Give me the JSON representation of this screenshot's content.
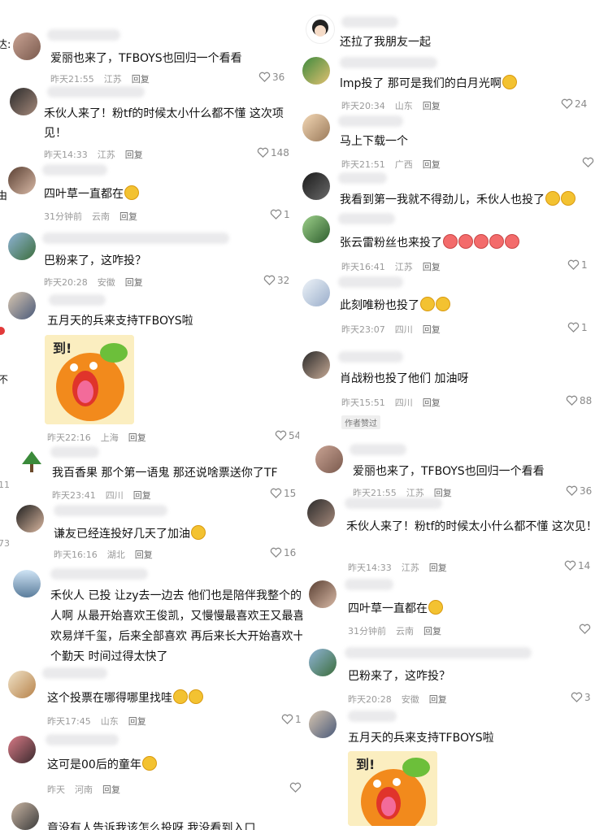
{
  "collage": {
    "left_top": [
      {
        "text": "爱丽也来了，TFBOYS也回归一个看看",
        "time": "昨天21:55",
        "region": "江苏",
        "reply": "回复",
        "likes": "36",
        "emoji": 0
      },
      {
        "text": "禾伙人来了！粉tf的时候太小什么都不懂 这次项见！",
        "time": "昨天14:33",
        "region": "江苏",
        "reply": "回复",
        "likes": "148",
        "emoji": 0
      },
      {
        "text": "四叶草一直都在",
        "time": "31分钟前",
        "region": "云南",
        "reply": "回复",
        "likes": "1",
        "emoji": 1
      },
      {
        "text": "巴粉来了，这咋投？",
        "time": "昨天20:28",
        "region": "安徽",
        "reply": "回复",
        "likes": "32",
        "emoji": 0
      },
      {
        "text": "五月天的兵来支持TFBOYS啦",
        "time": "昨天22:16",
        "region": "上海",
        "reply": "回复",
        "likes": "54",
        "emoji": 0
      }
    ],
    "left_bottom": [
      {
        "text": "我百香果 那个第一语鬼  那还说啥票送你了TF",
        "time": "昨天23:41",
        "region": "四川",
        "reply": "回复",
        "likes": "15"
      },
      {
        "text": "谦友已经连投好几天了加油",
        "time": "昨天16:16",
        "region": "湖北",
        "reply": "回复",
        "likes": "16"
      },
      {
        "text": "禾伙人 已投  让zy去一边去 他们也是陪伴我整个的人啊  从最开始喜欢王俊凯，又慢慢最喜欢王又最喜欢易烊千玺，后来全部喜欢 再后来长大开始喜欢十个勤天  时间过得太快了",
        "time": "",
        "region": "",
        "reply": "",
        "likes": ""
      },
      {
        "text": "这个投票在哪得哪里找哇",
        "time": "昨天17:45",
        "region": "山东",
        "reply": "回复",
        "likes": "1"
      },
      {
        "text": "这可是00后的童年",
        "time": "昨天",
        "region": "河南",
        "reply": "回复",
        "likes": ""
      },
      {
        "text": "竟没有人告诉我该怎么投呀 我没看到入口",
        "time": "",
        "region": "",
        "reply": "",
        "likes": ""
      }
    ],
    "right_top": [
      {
        "text": "还拉了我朋友一起",
        "time": "",
        "region": "",
        "reply": "",
        "likes": ""
      },
      {
        "text": "lmp投了 那可是我们的白月光啊",
        "time": "昨天20:34",
        "region": "山东",
        "reply": "回复",
        "likes": "24"
      },
      {
        "text": "马上下载一个",
        "time": "昨天21:51",
        "region": "广西",
        "reply": "回复",
        "likes": ""
      },
      {
        "text": "我看到第一我就不得劲儿，禾伙人也投了",
        "time": "",
        "region": "",
        "reply": "",
        "likes": ""
      },
      {
        "text": "张云雷粉丝也来投了",
        "time": "昨天16:41",
        "region": "江苏",
        "reply": "回复",
        "likes": "1"
      },
      {
        "text": "此刻唯粉也投了",
        "time": "昨天23:07",
        "region": "四川",
        "reply": "回复",
        "likes": "1"
      },
      {
        "text": "肖战粉也投了他们 加油呀",
        "time": "昨天15:51",
        "region": "四川",
        "reply": "回复",
        "likes": "88"
      }
    ],
    "author_liked": "作者赞过",
    "right_bottom": [
      {
        "text": "爱丽也来了，TFBOYS也回归一个看看",
        "time": "昨天21:55",
        "region": "江苏",
        "reply": "回复",
        "likes": "36"
      },
      {
        "text": "禾伙人来了！粉tf的时候太小什么都不懂 这次见！",
        "time": "昨天14:33",
        "region": "江苏",
        "reply": "回复",
        "likes": "14"
      },
      {
        "text": "四叶草一直都在",
        "time": "31分钟前",
        "region": "云南",
        "reply": "回复",
        "likes": ""
      },
      {
        "text": "巴粉来了，这咋投？",
        "time": "昨天20:28",
        "region": "安徽",
        "reply": "回复",
        "likes": "3"
      },
      {
        "text": "五月天的兵来支持TFBOYS啦",
        "time": "",
        "region": "",
        "reply": "",
        "likes": ""
      }
    ],
    "sticker_text": "到!",
    "colors": {
      "bg": "#ffffff",
      "text": "#121212",
      "meta": "#9a9a9a",
      "heart": "#8a8a8a",
      "emoji": "#f3c231",
      "sticker_orange": "#f28a1c",
      "sticker_green": "#6cbf3a"
    }
  }
}
